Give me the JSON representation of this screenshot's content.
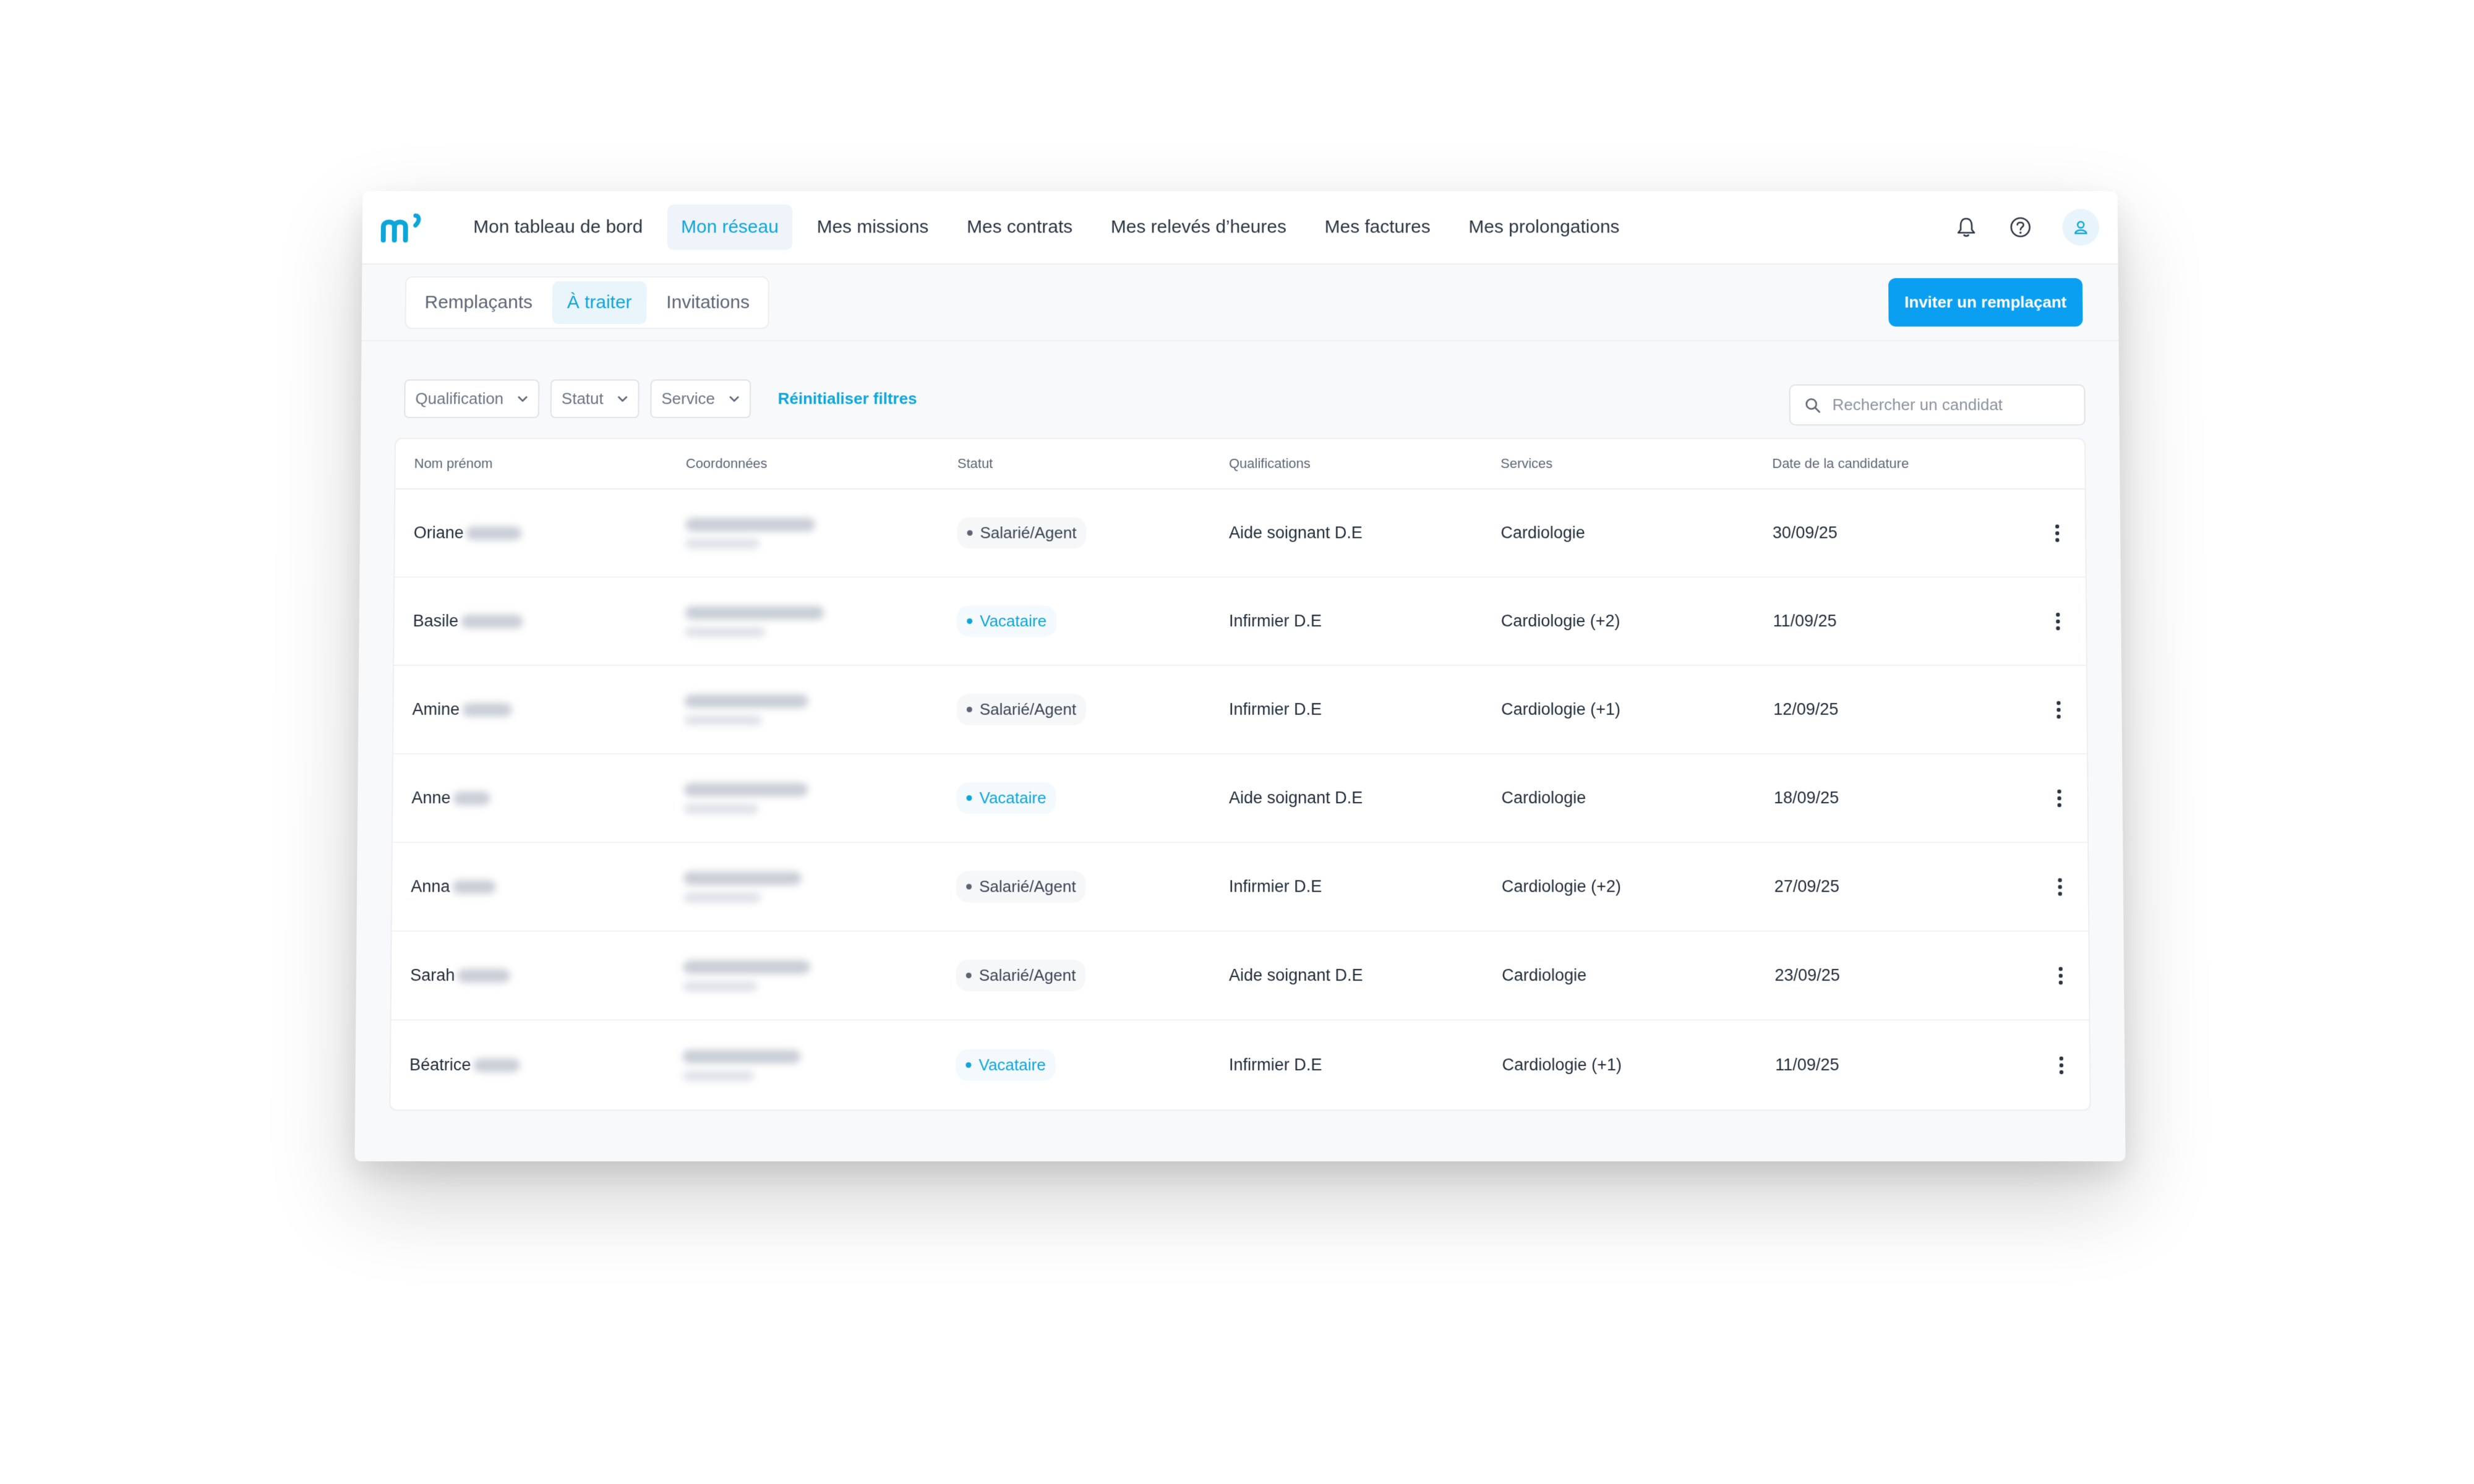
{
  "nav": {
    "items": [
      {
        "label": "Mon tableau de bord",
        "active": false
      },
      {
        "label": "Mon réseau",
        "active": true
      },
      {
        "label": "Mes missions",
        "active": false
      },
      {
        "label": "Mes contrats",
        "active": false
      },
      {
        "label": "Mes relevés d’heures",
        "active": false
      },
      {
        "label": "Mes factures",
        "active": false
      },
      {
        "label": "Mes prolongations",
        "active": false
      }
    ],
    "icons": [
      "bell-icon",
      "help-icon",
      "user-icon"
    ]
  },
  "tabs": [
    {
      "label": "Remplaçants",
      "active": false
    },
    {
      "label": "À traiter",
      "active": true
    },
    {
      "label": "Invitations",
      "active": false
    }
  ],
  "invite_button": "Inviter un remplaçant",
  "filters": {
    "qualification": "Qualification",
    "statut": "Statut",
    "service": "Service",
    "reset": "Réinitialiser filtres"
  },
  "search": {
    "placeholder": "Rechercher un candidat"
  },
  "table": {
    "headers": [
      "Nom prénom",
      "Coordonnées",
      "Statut",
      "Qualifications",
      "Services",
      "Date de la candidature"
    ],
    "rows": [
      {
        "first_name": "Oriane",
        "status": "Salarié/Agent",
        "status_type": "salarie",
        "qualification": "Aide soignant D.E",
        "service": "Cardiologie",
        "date": "30/09/25"
      },
      {
        "first_name": "Basile",
        "status": "Vacataire",
        "status_type": "vacataire",
        "qualification": "Infirmier D.E",
        "service": "Cardiologie (+2)",
        "date": "11/09/25"
      },
      {
        "first_name": "Amine",
        "status": "Salarié/Agent",
        "status_type": "salarie",
        "qualification": "Infirmier D.E",
        "service": "Cardiologie (+1)",
        "date": "12/09/25"
      },
      {
        "first_name": "Anne",
        "status": "Vacataire",
        "status_type": "vacataire",
        "qualification": "Aide soignant D.E",
        "service": "Cardiologie",
        "date": "18/09/25"
      },
      {
        "first_name": "Anna",
        "status": "Salarié/Agent",
        "status_type": "salarie",
        "qualification": "Infirmier D.E",
        "service": "Cardiologie (+2)",
        "date": "27/09/25"
      },
      {
        "first_name": "Sarah",
        "status": "Salarié/Agent",
        "status_type": "salarie",
        "qualification": "Aide soignant D.E",
        "service": "Cardiologie",
        "date": "23/09/25"
      },
      {
        "first_name": "Béatrice",
        "status": "Vacataire",
        "status_type": "vacataire",
        "qualification": "Infirmier D.E",
        "service": "Cardiologie (+1)",
        "date": "11/09/25"
      }
    ]
  },
  "colors": {
    "accent": "#0ea5d9",
    "button": "#0a9ff0"
  }
}
